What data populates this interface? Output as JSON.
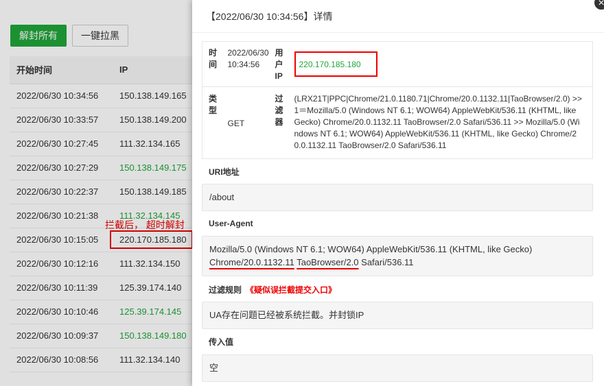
{
  "toolbar": {
    "unblock_all": "解封所有",
    "blacklist": "一键拉黑"
  },
  "table": {
    "headers": [
      "开始时间",
      "IP"
    ],
    "rows": [
      {
        "time": "2022/06/30 10:34:56",
        "ip": "150.138.149.165",
        "green": false
      },
      {
        "time": "2022/06/30 10:33:57",
        "ip": "150.138.149.200",
        "green": false
      },
      {
        "time": "2022/06/30 10:27:45",
        "ip": "111.32.134.165",
        "green": false
      },
      {
        "time": "2022/06/30 10:27:29",
        "ip": "150.138.149.175",
        "green": true
      },
      {
        "time": "2022/06/30 10:22:37",
        "ip": "150.138.149.185",
        "green": false
      },
      {
        "time": "2022/06/30 10:21:38",
        "ip": "111.32.134.145",
        "green": true
      },
      {
        "time": "2022/06/30 10:15:05",
        "ip": "220.170.185.180",
        "green": false,
        "highlight": true
      },
      {
        "time": "2022/06/30 10:12:16",
        "ip": "111.32.134.150",
        "green": false
      },
      {
        "time": "2022/06/30 10:11:39",
        "ip": "125.39.174.140",
        "green": false
      },
      {
        "time": "2022/06/30 10:10:46",
        "ip": "125.39.174.145",
        "green": true
      },
      {
        "time": "2022/06/30 10:09:37",
        "ip": "150.138.149.180",
        "green": true
      },
      {
        "time": "2022/06/30 10:08:56",
        "ip": "111.32.134.140",
        "green": false
      }
    ]
  },
  "annotation": "拦截后， 超时解封",
  "drawer": {
    "title": "【2022/06/30 10:34:56】详情",
    "close": "×",
    "time_label": "时间",
    "time_value": "2022/06/30 10:34:56",
    "user_ip_label": "用户IP",
    "user_ip_value": "220.170.185.180",
    "type_label": "类型",
    "type_value": "GET",
    "filter_label": "过滤器",
    "filter_value": "(LRX21T|PPC|Chrome/21.0.1180.71|Chrome/20.0.1132.11|TaoBrowser/2.0) >> 1＝Mozilla/5.0 (Windows NT 6.1; WOW64) AppleWebKit/536.11 (KHTML, like Gecko) Chrome/20.0.1132.11 TaoBrowser/2.0 Safari/536.11 >> Mozilla/5.0 (Windows NT 6.1; WOW64) AppleWebKit/536.11 (KHTML, like Gecko) Chrome/20.0.1132.11 TaoBrowser/2.0 Safari/536.11",
    "uri_label": "URI地址",
    "uri_value": "/about",
    "ua_label": "User-Agent",
    "ua_value_plain": "Mozilla/5.0 (Windows NT 6.1; WOW64) AppleWebKit/536.11 (KHTML, like Gecko) ",
    "ua_value_chrome": "Chrome/20.0.1132.11",
    "ua_value_sep": " ",
    "ua_value_tao": "TaoBrowser/2.0",
    "ua_value_tail": " Safari/536.11",
    "rule_label": "过滤规则",
    "rule_link": "《疑似误拦截提交入口》",
    "rule_value": "UA存在问题已经被系统拦截。并封锁IP",
    "input_label": "传入值",
    "input_value": "空"
  }
}
